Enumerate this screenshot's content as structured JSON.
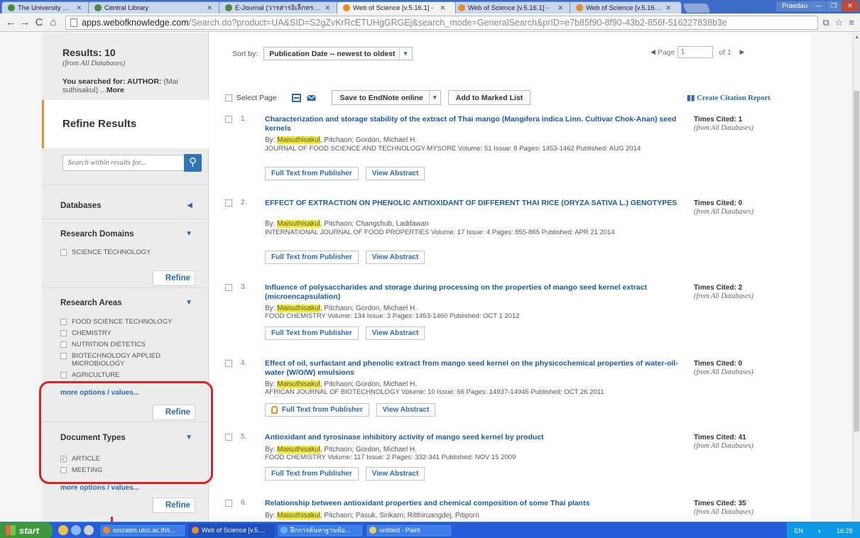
{
  "browser": {
    "tabs": [
      {
        "label": "The University of the Thai C",
        "active": false
      },
      {
        "label": "Central Library",
        "active": false
      },
      {
        "label": "E-Journal (วารสารอิเล็กทรอนิ",
        "active": false
      },
      {
        "label": "Web of Science [v.5.16.1] -",
        "active": true
      },
      {
        "label": "Web of Science [v.5.16.1] -",
        "active": false
      },
      {
        "label": "Web of Science [v.5.16.1] -",
        "active": false
      }
    ],
    "user": "Praedau",
    "url_host": "apps.webofknowledge.com",
    "url_rest": "/Search.do?product=UA&SID=S2gZvKrRcETUHgGRGEj&search_mode=GeneralSearch&prID=e7b85f90-8f90-43b2-856f-516227838b3e"
  },
  "sidebar": {
    "results_title": "Results: 10",
    "results_sub": "(from All Databases)",
    "searched_label": "You searched for: AUTHOR:",
    "searched_value": "(Mai suthisakul) ...",
    "searched_more": "More",
    "refine_title": "Refine Results",
    "search_placeholder": "Search within results for...",
    "refine_label": "Refine",
    "more_options": "more options / values...",
    "databases": "Databases",
    "research_domains": {
      "title": "Research Domains",
      "items": [
        "SCIENCE TECHNOLOGY"
      ]
    },
    "research_areas": {
      "title": "Research Areas",
      "items": [
        "FOOD SCIENCE TECHNOLOGY",
        "CHEMISTRY",
        "NUTRITION DIETETICS",
        "BIOTECHNOLOGY APPLIED MICROBIOLOGY",
        "AGRICULTURE"
      ]
    },
    "document_types": {
      "title": "Document Types",
      "items": [
        {
          "label": "ARTICLE",
          "checked": true
        },
        {
          "label": "MEETING",
          "checked": false
        }
      ]
    }
  },
  "main": {
    "sort_label": "Sort by:",
    "sort_value": "Publication Date -- newest to oldest",
    "page_label": "Page",
    "page_value": "1",
    "page_of": "of  1",
    "select_page": "Select Page",
    "save_endnote": "Save to EndNote online",
    "add_marked": "Add to Marked List",
    "create_citation": "Create Citation Report",
    "full_text": "Full Text from Publisher",
    "view_abstract": "View Abstract",
    "records": [
      {
        "num": "1.",
        "title": "Characterization and storage stability of the extract of Thai mango (Mangifera indica Linn. Cultivar Chok-Anan) seed kernels",
        "author_hl": "Maisuthisakul",
        "authors_rest": ", Pitchaon; Gordon, Michael H.",
        "source": "JOURNAL OF FOOD SCIENCE AND TECHNOLOGY-MYSORE  Volume: 51   Issue: 8   Pages: 1453-1462   Published: AUG 2014",
        "cited": "Times Cited: 1"
      },
      {
        "num": "2.",
        "title": "EFFECT OF EXTRACTION ON PHENOLIC ANTIOXIDANT OF DIFFERENT THAI RICE (ORYZA SATIVA L.) GENOTYPES",
        "author_hl": "Maisuthisakul",
        "authors_rest": ", Pitchaon; Changchub, Laddawan",
        "source": "INTERNATIONAL JOURNAL OF FOOD PROPERTIES  Volume: 17   Issue: 4   Pages: 855-865   Published: APR 21 2014",
        "cited": "Times Cited: 0"
      },
      {
        "num": "3.",
        "title": "Influence of polysaccharides and storage during processing on the properties of mango seed kernel extract (microencapsulation)",
        "author_hl": "Maisuthisakul",
        "authors_rest": ", Pitchaon; Gordon, Michael H.",
        "source": "FOOD CHEMISTRY  Volume: 134   Issue: 3   Pages: 1453-1460   Published: OCT 1 2012",
        "cited": "Times Cited: 2"
      },
      {
        "num": "4.",
        "title": "Effect of oil, surfactant and phenolic extract from mango seed kernel on the physicochemical properties of water-oil-water (W/O/W) emulsions",
        "author_hl": "Maisuthisakul",
        "authors_rest": ", Pitchaon; Gordon, Michael H.",
        "source": "AFRICAN JOURNAL OF BIOTECHNOLOGY  Volume: 10   Issue: 66   Pages: 14937-14946   Published: OCT 26 2011",
        "cited": "Times Cited: 0"
      },
      {
        "num": "5.",
        "title": "Antioxidant and tyrosinase inhibitory activity of mango seed kernel by product",
        "author_hl": "Maisuthisakul",
        "authors_rest": ", Pitchaon; Gordon, Michael H.",
        "source": "FOOD CHEMISTRY  Volume: 117   Issue: 2   Pages: 332-341   Published: NOV 15 2009",
        "cited": "Times Cited: 41"
      },
      {
        "num": "6.",
        "title": "Relationship between antioxidant properties and chemical composition of some Thai plants",
        "author_hl": "Maisuthisakul",
        "authors_rest": ", Pitchaon; Pasuk, Sirikarn; Ritthiruangdej, Pitiporn",
        "cited": "Times Cited: 35"
      }
    ],
    "cited_sub": "(from All Databases)"
  },
  "taskbar": {
    "start": "start",
    "items": [
      "socrates.utcc.ac.th/r...",
      "Web of Science [v.5....",
      "ฝึกการค้นหาฐานข้อ...",
      "untitled - Paint"
    ],
    "lang": "EN",
    "time": "16:29"
  },
  "colors": {
    "link": "#1b5aa5",
    "accent": "#e88e2d",
    "highlight": "#f2ea2f",
    "annotation": "#e02020"
  }
}
